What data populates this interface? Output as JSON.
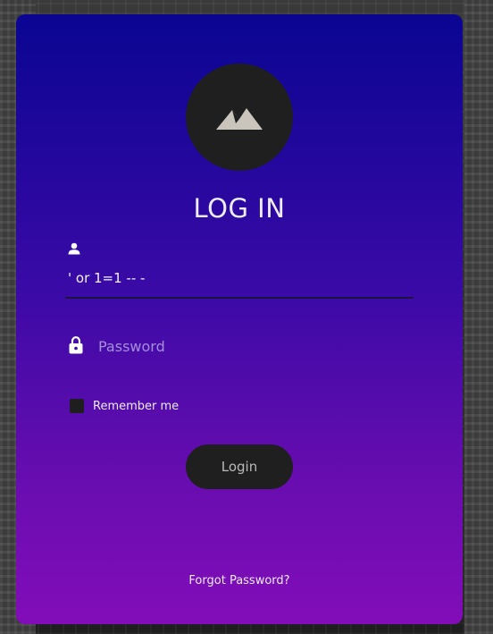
{
  "login_card": {
    "title": "LOG IN",
    "logo_icon": "mountain-icon",
    "username": {
      "icon": "user-icon",
      "value": "' or 1=1 -- -"
    },
    "password": {
      "icon": "lock-icon",
      "placeholder": "Password",
      "value": ""
    },
    "remember_me": {
      "label": "Remember me",
      "checked": false
    },
    "login_button": "Login",
    "forgot_password": "Forgot Password?"
  },
  "colors": {
    "card_gradient_top": "#0a0592",
    "card_gradient_bottom": "#820db8",
    "dark_control": "#1f1f1f",
    "text_light": "#ececf2",
    "placeholder": "#a68fd9"
  }
}
